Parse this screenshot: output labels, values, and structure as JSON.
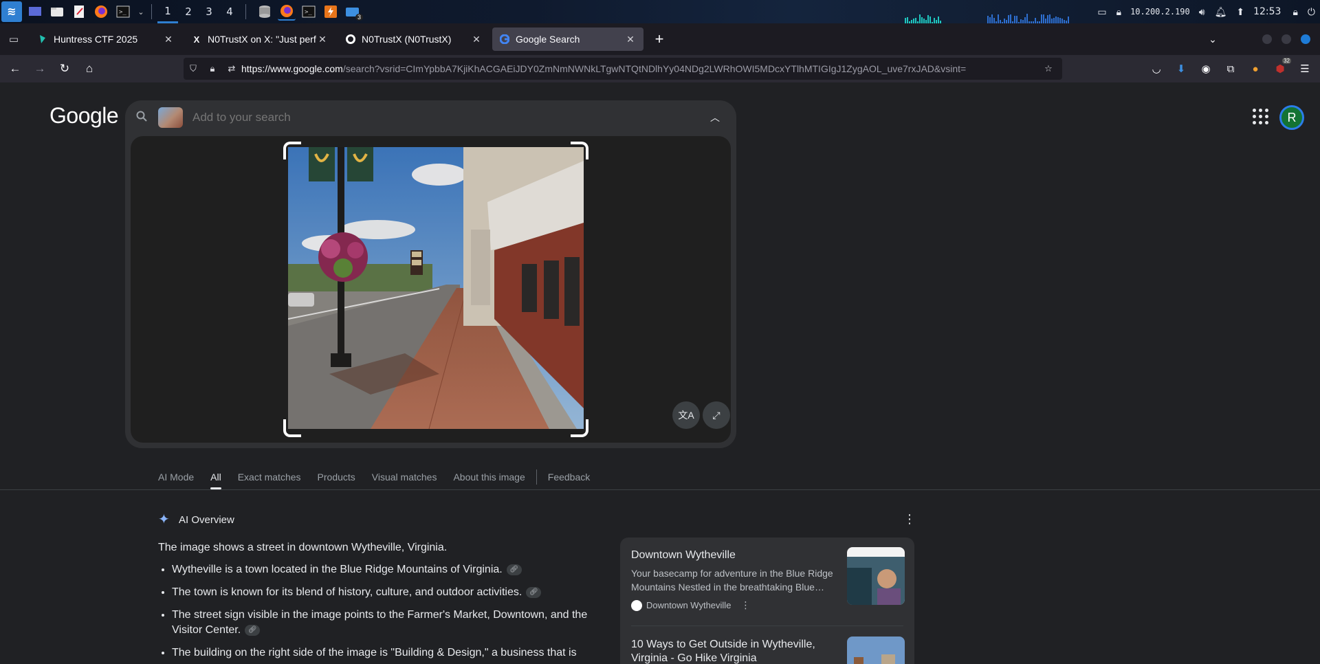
{
  "taskbar": {
    "workspaces": [
      "1",
      "2",
      "3",
      "4"
    ],
    "folder_badge": "3",
    "ip": "10.200.2.190",
    "clock": "12:53"
  },
  "tabs": [
    {
      "title": "Huntress CTF 2025",
      "favicon": "huntress-icon"
    },
    {
      "title": "N0TrustX on X: \"Just perf",
      "favicon": "x-icon"
    },
    {
      "title": "N0TrustX (N0TrustX)",
      "favicon": "github-icon"
    },
    {
      "title": "Google Search",
      "favicon": "google-icon",
      "active": true
    }
  ],
  "url": {
    "host": "https://www.google.com",
    "rest": "/search?vsrid=CImYpbbA7KjiKhACGAEiJDY0ZmNmNWNkLTgwNTQtNDlhYy04NDg2LWRhOWI5MDcxYTlhMTIGIgJ1ZygAOL_uve7rxJAD&vsint="
  },
  "extensions_badge": "32",
  "google": {
    "logo": "Google",
    "search_placeholder": "Add to your search",
    "avatar_letter": "R"
  },
  "filters": [
    {
      "label": "AI Mode"
    },
    {
      "label": "All",
      "active": true
    },
    {
      "label": "Exact matches"
    },
    {
      "label": "Products"
    },
    {
      "label": "Visual matches"
    },
    {
      "label": "About this image"
    },
    {
      "label": "Feedback"
    }
  ],
  "ai_overview": {
    "heading": "AI Overview",
    "intro": "The image shows a street in downtown Wytheville, Virginia.",
    "bullets": [
      "Wytheville is a town located in the Blue Ridge Mountains of Virginia.",
      "The town is known for its blend of history, culture, and outdoor activities.",
      "The street sign visible in the image points to the Farmer's Market, Downtown, and the Visitor Center.",
      "The building on the right side of the image is \"Building & Design,\" a business that is"
    ]
  },
  "cards": [
    {
      "title": "Downtown Wytheville",
      "snippet": "Your basecamp for adventure in the Blue Ridge Mountains Nestled in the breathtaking Blue…",
      "source": "Downtown Wytheville"
    },
    {
      "title": "10 Ways to Get Outside in Wytheville, Virginia - Go Hike Virginia"
    }
  ],
  "colors": {
    "page_bg": "#202124",
    "accent_blue": "#8ab4f8",
    "avatar_green": "#137333"
  }
}
